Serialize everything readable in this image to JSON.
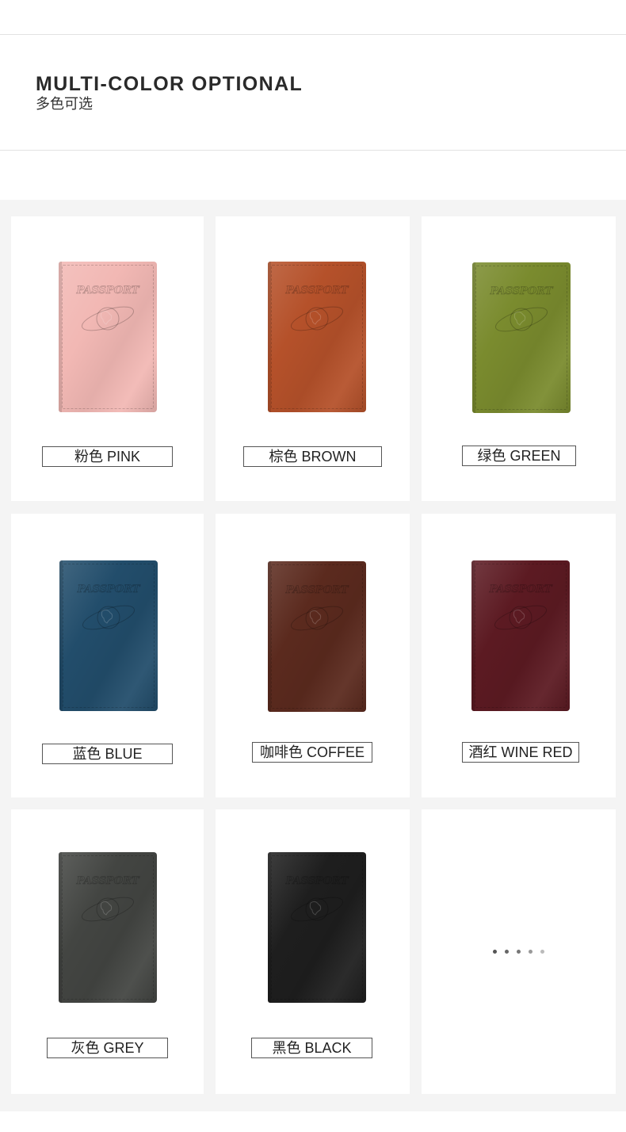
{
  "header": {
    "title": "MULTI-COLOR OPTIONAL",
    "subtitle": "多色可选"
  },
  "colors": [
    {
      "label": "粉色 PINK",
      "color": "#f2b8b4",
      "embossed_text": "PASSPORT"
    },
    {
      "label": "棕色 BROWN",
      "color": "#b5512a",
      "embossed_text": "PASSPORT"
    },
    {
      "label": "绿色 GREEN",
      "color": "#7a8b2e",
      "embossed_text": "PASSPORT"
    },
    {
      "label": "蓝色 BLUE",
      "color": "#224d6b",
      "embossed_text": "PASSPORT"
    },
    {
      "label": "咖啡色 COFFEE",
      "color": "#5b2a1e",
      "embossed_text": "PASSPORT"
    },
    {
      "label": "酒红 WINE RED",
      "color": "#5c1a22",
      "embossed_text": "PASSPORT"
    },
    {
      "label": "灰色 GREY",
      "color": "#434542",
      "embossed_text": "PASSPORT"
    },
    {
      "label": "黑色 BLACK",
      "color": "#1e1e1e",
      "embossed_text": "PASSPORT"
    }
  ],
  "more_indicator": {
    "dot_colors": [
      "#555555",
      "#666666",
      "#777777",
      "#999999",
      "#bbbbbb"
    ]
  }
}
